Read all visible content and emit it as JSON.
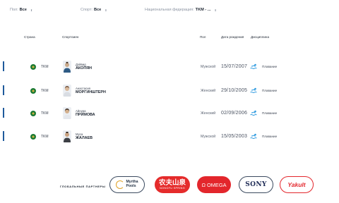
{
  "filters": {
    "gender": {
      "label": "Пол:",
      "value": "Все"
    },
    "sport": {
      "label": "Спорт:",
      "value": "Все"
    },
    "federation": {
      "label": "Национальная федерация:",
      "value": "TKM - ..."
    },
    "chevron_icon": "chevron-updown-icon"
  },
  "table": {
    "headers": {
      "country": "Страна",
      "athlete": "Спортсмен",
      "gender": "Пол",
      "dob": "Дата рождения",
      "discipline": "Дисциплина"
    },
    "rows": [
      {
        "country": "TKM",
        "first_name": "Дэйвид",
        "last_name": "АКОПЯН",
        "gender": "Мужской",
        "dob": "15/07/2007",
        "discipline": "Плавание"
      },
      {
        "country": "TKM",
        "first_name": "Анастасия",
        "last_name": "МОРГИНШТЕРН",
        "gender": "Женский",
        "dob": "29/10/2005",
        "discipline": "Плавание"
      },
      {
        "country": "TKM",
        "first_name": "Айнура",
        "last_name": "ПРИМОВА",
        "gender": "Женский",
        "dob": "02/09/2006",
        "discipline": "Плавание"
      },
      {
        "country": "TKM",
        "first_name": "Муса",
        "last_name": "ЖАЛАЕВ",
        "gender": "Мужской",
        "dob": "15/05/2003",
        "discipline": "Плавание"
      }
    ],
    "flag_icon": "turkmenistan-flag-icon",
    "discipline_icon": "swimming-icon"
  },
  "partners": {
    "label": "ГЛОБАЛЬНЫЕ ПАРТНЕРЫ",
    "logos": [
      {
        "name": "Myrtha Pools",
        "line1": "Myrtha",
        "line2": "Pools"
      },
      {
        "name": "Nongfu Spring",
        "big": "农夫山泉",
        "small": "NONGFU SPRING"
      },
      {
        "name": "Omega",
        "text": "Ω OMEGA"
      },
      {
        "name": "Sony",
        "text": "SONY"
      },
      {
        "name": "Yakult",
        "text": "Yakult"
      }
    ]
  },
  "colors": {
    "accent_bar": "#1f5a9c",
    "flag_green": "#1a7a33",
    "swim_icon": "#2f9be0",
    "partner_red": "#e3262c"
  }
}
